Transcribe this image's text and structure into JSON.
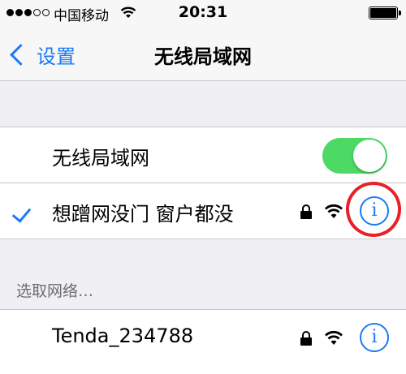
{
  "status_bar": {
    "carrier": "中国移动",
    "time": "20:31"
  },
  "nav": {
    "back_label": "设置",
    "title": "无线局域网"
  },
  "wifi_toggle": {
    "label": "无线局域网",
    "on": true
  },
  "connected_network": {
    "name": "想蹭网没门 窗户都没",
    "selected": true,
    "secured": true
  },
  "choose_network": {
    "header": "选取网络…",
    "networks": [
      {
        "name": "Tenda_234788",
        "secured": true
      }
    ]
  },
  "colors": {
    "accent": "#1a7af8",
    "toggle_on": "#4cd964",
    "annotation": "#e8202a"
  },
  "icons": [
    "signal-dots-icon",
    "wifi-icon",
    "battery-icon",
    "chevron-left-icon",
    "checkmark-icon",
    "lock-icon",
    "info-icon"
  ]
}
